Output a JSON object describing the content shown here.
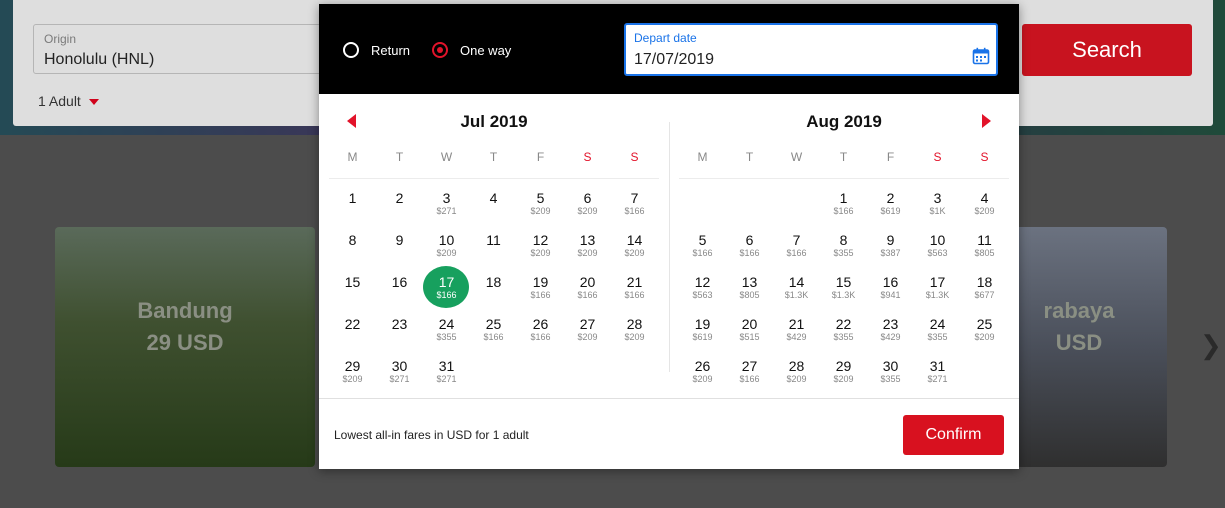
{
  "search": {
    "origin_label": "Origin",
    "origin_value": "Honolulu (HNL)",
    "passengers": "1 Adult",
    "search_label": "Search"
  },
  "cards": [
    {
      "city": "Bandung",
      "price": "29 USD"
    },
    {
      "city": "rabaya",
      "price": "USD"
    }
  ],
  "modal": {
    "trip_return": "Return",
    "trip_oneway": "One way",
    "depart_label": "Depart date",
    "depart_value": "17/07/2019",
    "footer_note": "Lowest all-in fares in USD for 1 adult",
    "confirm_label": "Confirm"
  },
  "weekdays": [
    "M",
    "T",
    "W",
    "T",
    "F",
    "S",
    "S"
  ],
  "colors": {
    "accent": "#e2132a",
    "selected": "#17a05e",
    "focus": "#1a73e8"
  },
  "months": [
    {
      "title": "Jul 2019",
      "offset": 0,
      "days": [
        [
          "1",
          ""
        ],
        [
          "2",
          ""
        ],
        [
          "3",
          "$271"
        ],
        [
          "4",
          ""
        ],
        [
          "5",
          "$209"
        ],
        [
          "6",
          "$209"
        ],
        [
          "7",
          "$166"
        ],
        [
          "8",
          ""
        ],
        [
          "9",
          ""
        ],
        [
          "10",
          "$209"
        ],
        [
          "11",
          ""
        ],
        [
          "12",
          "$209"
        ],
        [
          "13",
          "$209"
        ],
        [
          "14",
          "$209"
        ],
        [
          "15",
          ""
        ],
        [
          "16",
          ""
        ],
        [
          "17",
          "$166"
        ],
        [
          "18",
          ""
        ],
        [
          "19",
          "$166"
        ],
        [
          "20",
          "$166"
        ],
        [
          "21",
          "$166"
        ],
        [
          "22",
          ""
        ],
        [
          "23",
          ""
        ],
        [
          "24",
          "$355"
        ],
        [
          "25",
          "$166"
        ],
        [
          "26",
          "$166"
        ],
        [
          "27",
          "$209"
        ],
        [
          "28",
          "$209"
        ],
        [
          "29",
          "$209"
        ],
        [
          "30",
          "$271"
        ],
        [
          "31",
          "$271"
        ]
      ],
      "selected": "17"
    },
    {
      "title": "Aug 2019",
      "offset": 3,
      "days": [
        [
          "1",
          "$166"
        ],
        [
          "2",
          "$619"
        ],
        [
          "3",
          "$1K"
        ],
        [
          "4",
          "$209"
        ],
        [
          "5",
          "$166"
        ],
        [
          "6",
          "$166"
        ],
        [
          "7",
          "$166"
        ],
        [
          "8",
          "$355"
        ],
        [
          "9",
          "$387"
        ],
        [
          "10",
          "$563"
        ],
        [
          "11",
          "$805"
        ],
        [
          "12",
          "$563"
        ],
        [
          "13",
          "$805"
        ],
        [
          "14",
          "$1.3K"
        ],
        [
          "15",
          "$1.3K"
        ],
        [
          "16",
          "$941"
        ],
        [
          "17",
          "$1.3K"
        ],
        [
          "18",
          "$677"
        ],
        [
          "19",
          "$619"
        ],
        [
          "20",
          "$515"
        ],
        [
          "21",
          "$429"
        ],
        [
          "22",
          "$355"
        ],
        [
          "23",
          "$429"
        ],
        [
          "24",
          "$355"
        ],
        [
          "25",
          "$209"
        ],
        [
          "26",
          "$209"
        ],
        [
          "27",
          "$166"
        ],
        [
          "28",
          "$209"
        ],
        [
          "29",
          "$209"
        ],
        [
          "30",
          "$355"
        ],
        [
          "31",
          "$271"
        ]
      ],
      "selected": ""
    }
  ]
}
